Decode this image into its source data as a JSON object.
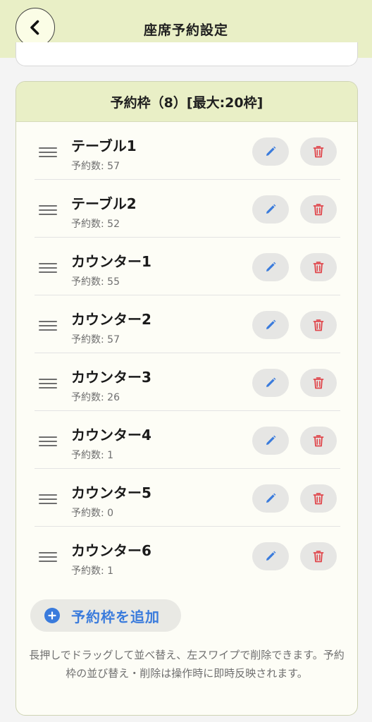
{
  "header": {
    "title": "座席予約設定"
  },
  "section": {
    "title": "予約枠（8）[最大:20枠]"
  },
  "slots": [
    {
      "name": "テーブル1",
      "count": "予約数: 57"
    },
    {
      "name": "テーブル2",
      "count": "予約数: 52"
    },
    {
      "name": "カウンター1",
      "count": "予約数: 55"
    },
    {
      "name": "カウンター2",
      "count": "予約数: 57"
    },
    {
      "name": "カウンター3",
      "count": "予約数: 26"
    },
    {
      "name": "カウンター4",
      "count": "予約数: 1"
    },
    {
      "name": "カウンター5",
      "count": "予約数: 0"
    },
    {
      "name": "カウンター6",
      "count": "予約数: 1"
    }
  ],
  "add_button": {
    "label": "予約枠を追加"
  },
  "help_text": "長押しでドラッグして並べ替え、左スワイプで削除できます。予約枠の並び替え・削除は操作時に即時反映されます。",
  "icons": {
    "back": "chevron-left-icon",
    "drag": "drag-handle-icon",
    "edit": "pencil-icon",
    "delete": "trash-icon",
    "add": "plus-circle-icon"
  },
  "colors": {
    "header_bg": "#e9efc6",
    "accent_blue": "#3a7bdc",
    "delete_red": "#e0474c"
  }
}
